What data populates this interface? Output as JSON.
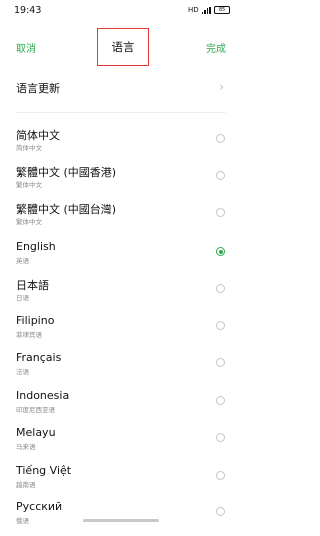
{
  "status_bar": {
    "time": "19:43",
    "network": "HD",
    "battery": "85"
  },
  "header": {
    "cancel": "取消",
    "title": "语言",
    "done": "完成"
  },
  "update_row": {
    "label": "语言更新"
  },
  "languages": [
    {
      "name": "简体中文",
      "sub": "简体中文",
      "selected": false
    },
    {
      "name": "繁體中文 (中國香港)",
      "sub": "繁体中文",
      "selected": false
    },
    {
      "name": "繁體中文 (中國台灣)",
      "sub": "繁体中文",
      "selected": false
    },
    {
      "name": "English",
      "sub": "英语",
      "selected": true
    },
    {
      "name": "日本語",
      "sub": "日语",
      "selected": false
    },
    {
      "name": "Filipino",
      "sub": "菲律宾语",
      "selected": false
    },
    {
      "name": "Français",
      "sub": "法语",
      "selected": false
    },
    {
      "name": "Indonesia",
      "sub": "印度尼西亚语",
      "selected": false
    },
    {
      "name": "Melayu",
      "sub": "马来语",
      "selected": false
    },
    {
      "name": "Tiếng Việt",
      "sub": "越南语",
      "selected": false
    },
    {
      "name": "Русский",
      "sub": "俄语",
      "selected": false
    }
  ]
}
